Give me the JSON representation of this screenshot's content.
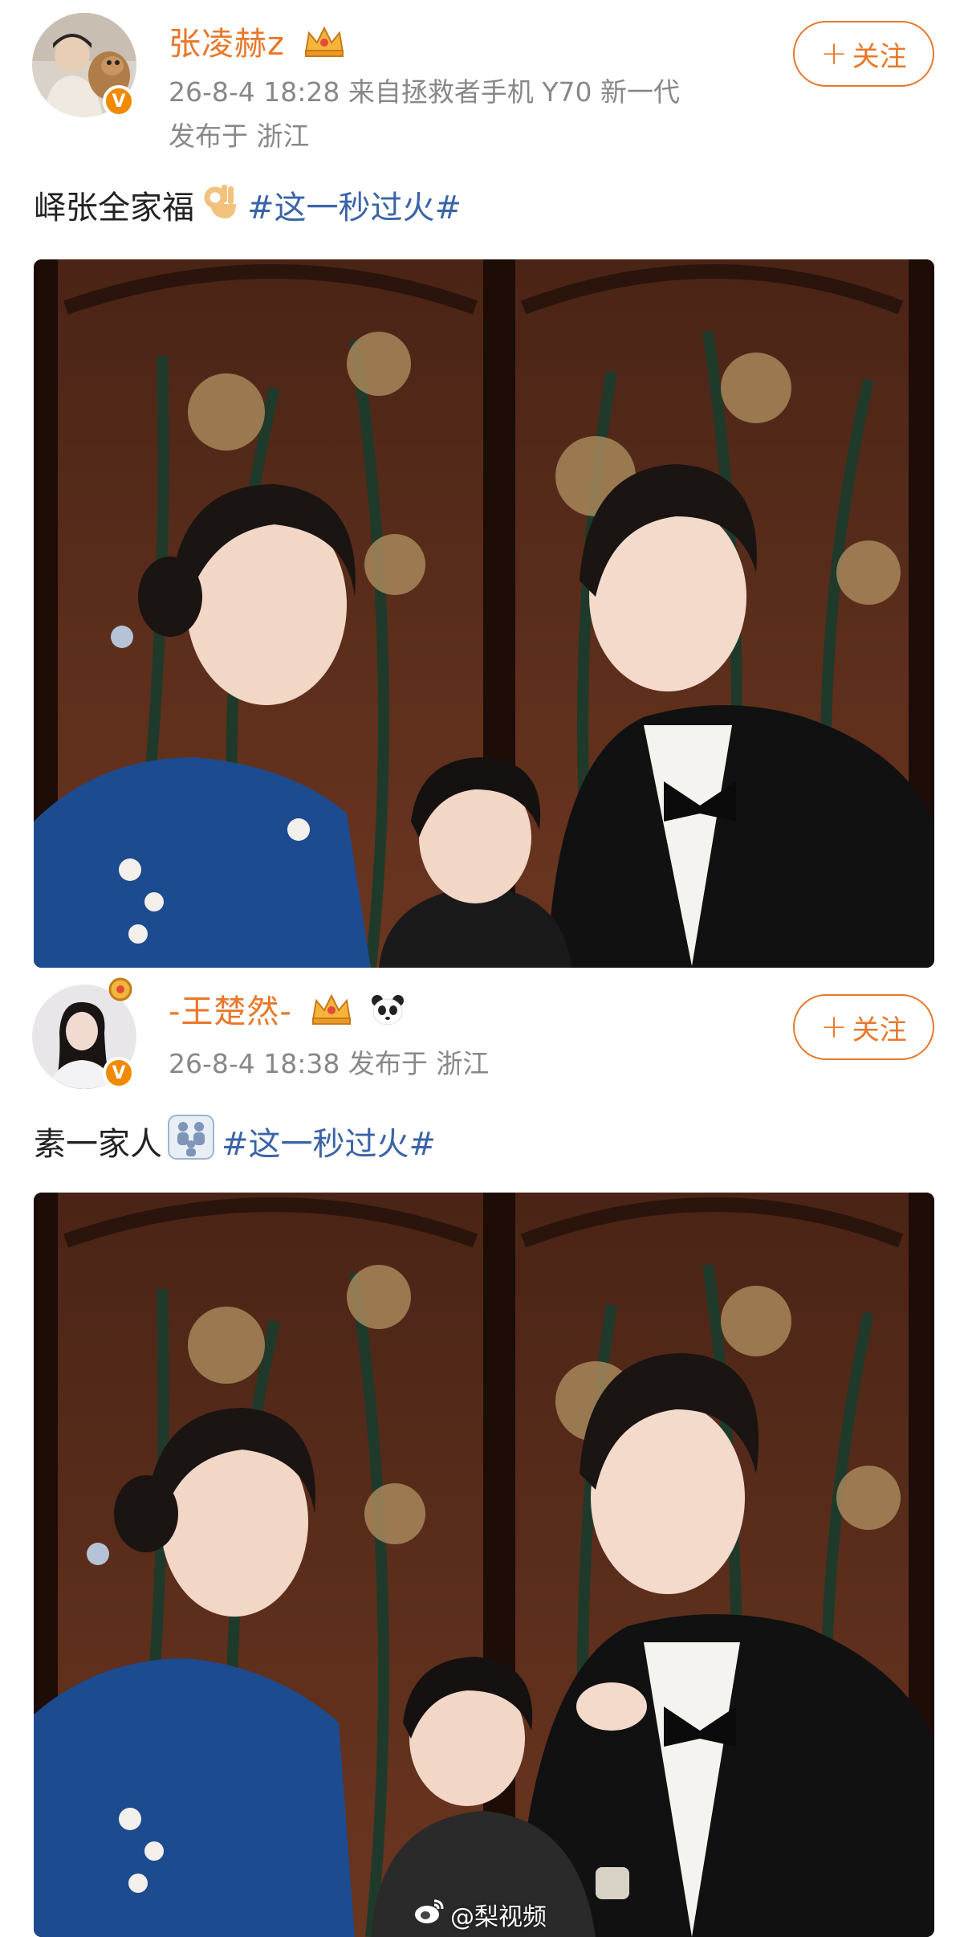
{
  "posts": [
    {
      "username": "张凌赫z",
      "meta_line1": "26-8-4 18:28  来自拯救者手机 Y70 新一代",
      "meta_line2": "发布于 浙江",
      "follow_label": "关注",
      "text": "峄张全家福",
      "hashtag": "#这一秒过火#",
      "colors": {
        "username": "#e8782a",
        "hashtag": "#3b64a8",
        "badge": "#f08a00"
      }
    },
    {
      "username": "-王楚然-",
      "meta_line1": "26-8-4 18:38  发布于 浙江",
      "follow_label": "关注",
      "text": "素一家人",
      "hashtag": "#这一秒过火#"
    }
  ],
  "watermark": {
    "text": "@梨视频",
    "icon": "weibo-icon"
  },
  "icons": [
    "crown-icon",
    "ok-hand-emoji-icon",
    "family-emoji-icon",
    "panda-emoji-icon",
    "verified-badge-icon",
    "plus-icon"
  ]
}
